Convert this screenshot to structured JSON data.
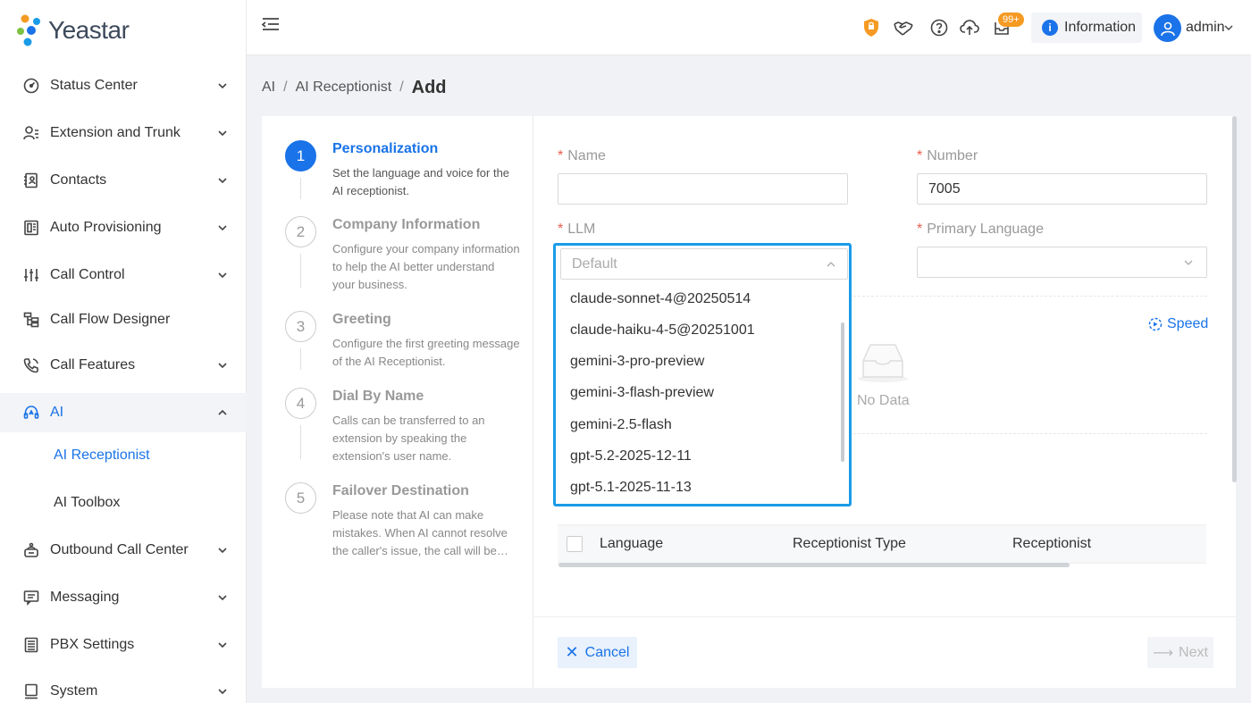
{
  "brand": {
    "name": "Yeastar"
  },
  "sidebar": {
    "items": [
      {
        "label": "Status Center",
        "icon": "gauge-icon"
      },
      {
        "label": "Extension and Trunk",
        "icon": "user-list-icon"
      },
      {
        "label": "Contacts",
        "icon": "contacts-icon"
      },
      {
        "label": "Auto Provisioning",
        "icon": "provisioning-icon"
      },
      {
        "label": "Call Control",
        "icon": "sliders-icon"
      },
      {
        "label": "Call Flow Designer",
        "icon": "flow-icon"
      },
      {
        "label": "Call Features",
        "icon": "phone-icon"
      },
      {
        "label": "AI",
        "icon": "ai-headset-icon"
      },
      {
        "label": "Outbound Call Center",
        "icon": "outbound-icon"
      },
      {
        "label": "Messaging",
        "icon": "message-icon"
      },
      {
        "label": "PBX Settings",
        "icon": "settings-list-icon"
      },
      {
        "label": "System",
        "icon": "monitor-icon"
      }
    ],
    "ai_sub": [
      {
        "label": "AI Receptionist"
      },
      {
        "label": "AI Toolbox"
      }
    ]
  },
  "header": {
    "notification_badge": "99+",
    "information_label": "Information",
    "user_label": "admin"
  },
  "breadcrumb": {
    "root": "AI",
    "parent": "AI Receptionist",
    "current": "Add"
  },
  "steps": [
    {
      "num": "1",
      "title": "Personalization",
      "desc": "Set the language and voice for the AI receptionist."
    },
    {
      "num": "2",
      "title": "Company Information",
      "desc": "Configure your company information to help the AI better understand your business."
    },
    {
      "num": "3",
      "title": "Greeting",
      "desc": "Configure the first greeting message of the AI Receptionist."
    },
    {
      "num": "4",
      "title": "Dial By Name",
      "desc": "Calls can be transferred to an extension by speaking the extension's user name."
    },
    {
      "num": "5",
      "title": "Failover Destination",
      "desc": "Please note that AI can make mistakes. When AI cannot resolve the caller's issue, the call will be…"
    }
  ],
  "form": {
    "required_mark": "*",
    "name_label": "Name",
    "name_value": "",
    "number_label": "Number",
    "number_value": "7005",
    "llm_label": "LLM",
    "llm_placeholder": "Default",
    "primary_language_label": "Primary Language",
    "primary_language_value": "",
    "speed_label": "Speed",
    "no_data": "No Data"
  },
  "llm_options": [
    "claude-sonnet-4@20250514",
    "claude-haiku-4-5@20251001",
    "gemini-3-pro-preview",
    "gemini-3-flash-preview",
    "gemini-2.5-flash",
    "gpt-5.2-2025-12-11",
    "gpt-5.1-2025-11-13"
  ],
  "table": {
    "columns": [
      "Language",
      "Receptionist Type",
      "Receptionist"
    ]
  },
  "footer": {
    "cancel_label": "Cancel",
    "next_label": "Next"
  },
  "colors": {
    "accent": "#1a73e8",
    "badge": "#f59a23",
    "required": "#e85d4a",
    "dropdown_outline": "#1a9be8"
  }
}
